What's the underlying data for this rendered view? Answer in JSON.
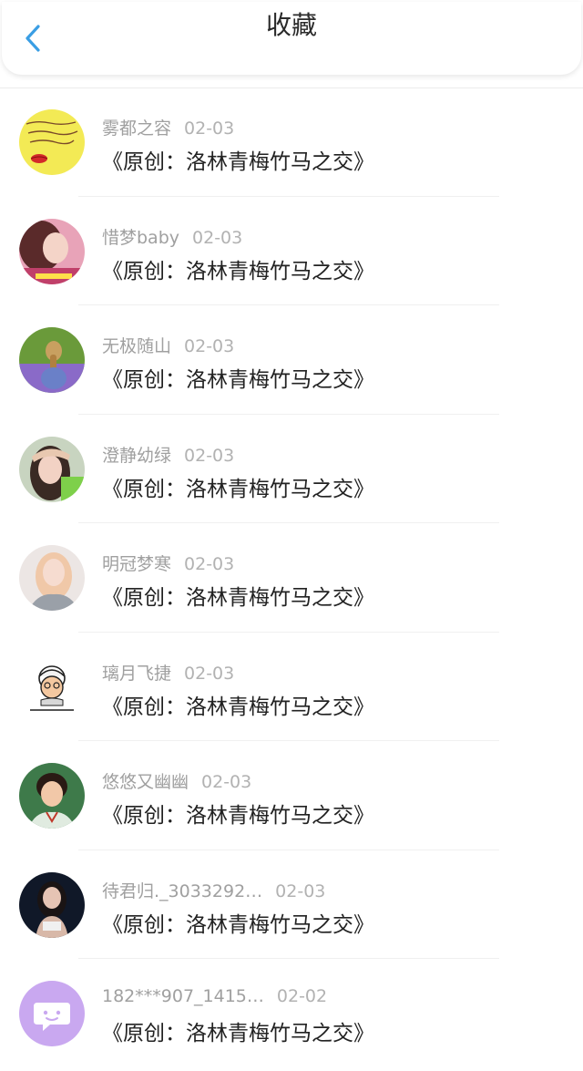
{
  "header": {
    "title": "收藏",
    "back_icon": "chevron-left-icon",
    "accent": "#3a9ee4"
  },
  "items": [
    {
      "author": "雾都之容",
      "date": "02-03",
      "title": "《原创：洛林青梅竹马之交》",
      "avatar": "yellow-note-avatar"
    },
    {
      "author": "惜梦baby",
      "date": "02-03",
      "title": "《原创：洛林青梅竹马之交》",
      "avatar": "girl-pink-avatar"
    },
    {
      "author": "无极随山",
      "date": "02-03",
      "title": "《原创：洛林青梅竹马之交》",
      "avatar": "girl-field-avatar"
    },
    {
      "author": "澄静幼绿",
      "date": "02-03",
      "title": "《原创：洛林青梅竹马之交》",
      "avatar": "girl-cap-avatar"
    },
    {
      "author": "明冠梦寒",
      "date": "02-03",
      "title": "《原创：洛林青梅竹马之交》",
      "avatar": "girl-blonde-avatar"
    },
    {
      "author": "璃月飞捷",
      "date": "02-03",
      "title": "《原创：洛林青梅竹马之交》",
      "avatar": "cartoon-avatar"
    },
    {
      "author": "悠悠又幽幽",
      "date": "02-03",
      "title": "《原创：洛林青梅竹马之交》",
      "avatar": "woman-green-avatar"
    },
    {
      "author": "待君归._3033292…",
      "date": "02-03",
      "title": "《原创：洛林青梅竹马之交》",
      "avatar": "girl-dark-avatar"
    },
    {
      "author": "182***907_1415…",
      "date": "02-02",
      "title": "《原创：洛林青梅竹马之交》",
      "avatar": "default-chat-avatar"
    }
  ]
}
